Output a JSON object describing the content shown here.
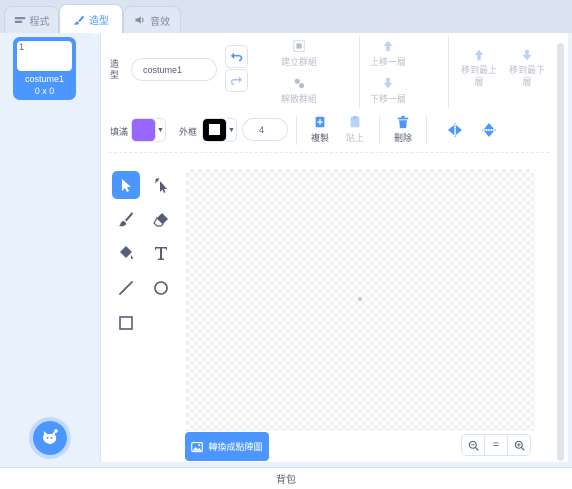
{
  "tabs": [
    {
      "label": "程式",
      "icon": "code-icon"
    },
    {
      "label": "造型",
      "icon": "brush-icon"
    },
    {
      "label": "音效",
      "icon": "speaker-icon"
    }
  ],
  "costume_list": {
    "items": [
      {
        "number": "1",
        "name": "costume1",
        "size": "0 x 0"
      }
    ]
  },
  "editor": {
    "costume_label": "造型",
    "costume_name": "costume1",
    "group_label": "建立群組",
    "ungroup_label": "解散群組",
    "forward_label": "上移一層",
    "backward_label": "下移一層",
    "front_label": "移到最上層",
    "back_label": "移到最下層",
    "fill_label": "填滿",
    "fill_color": "#9966ff",
    "outline_label": "外框",
    "outline_color": "#000000",
    "outline_width": "4",
    "copy_label": "複製",
    "paste_label": "貼上",
    "delete_label": "刪除",
    "convert_label": "轉換成點陣圖",
    "zoom_out": "−",
    "zoom_reset": "=",
    "zoom_in": "+"
  },
  "backpack": {
    "label": "背包"
  },
  "colors": {
    "accent": "#4c97ff",
    "fill": "#9966ff",
    "text": "#575e75"
  }
}
